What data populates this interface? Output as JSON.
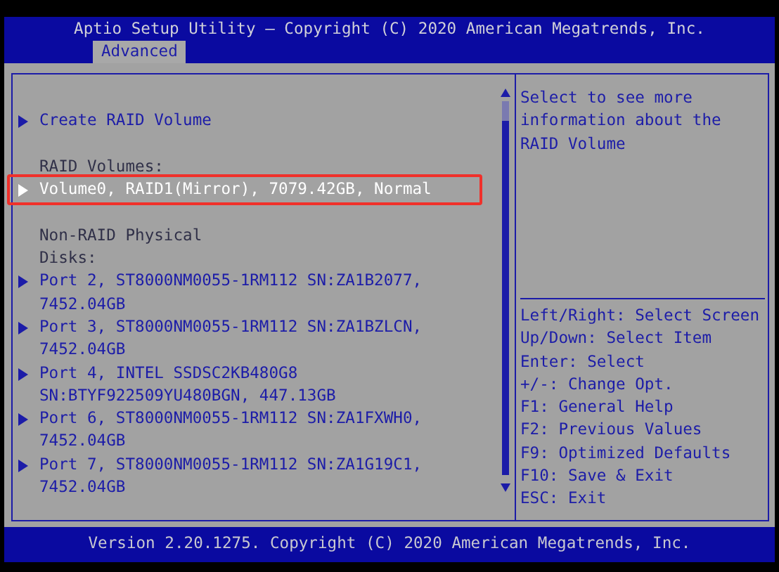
{
  "title": "Aptio Setup Utility – Copyright (C) 2020 American Megatrends, Inc.",
  "tabs": [
    {
      "label": "Advanced",
      "selected": true
    }
  ],
  "items": [
    {
      "kind": "blank"
    },
    {
      "kind": "link",
      "lines": [
        "Create RAID Volume"
      ],
      "selected": false
    },
    {
      "kind": "blank"
    },
    {
      "kind": "label",
      "lines": [
        "RAID Volumes:"
      ]
    },
    {
      "kind": "link",
      "lines": [
        "Volume0, RAID1(Mirror), 7079.42GB, Normal"
      ],
      "selected": true
    },
    {
      "kind": "blank"
    },
    {
      "kind": "label",
      "lines": [
        "Non-RAID Physical",
        "Disks:"
      ]
    },
    {
      "kind": "link",
      "lines": [
        "Port 2, ST8000NM0055-1RM112 SN:ZA1B2077,",
        "7452.04GB"
      ],
      "selected": false
    },
    {
      "kind": "link",
      "lines": [
        "Port 3, ST8000NM0055-1RM112 SN:ZA1BZLCN,",
        "7452.04GB"
      ],
      "selected": false
    },
    {
      "kind": "link",
      "lines": [
        "Port 4, INTEL SSDSC2KB480G8",
        "SN:BTYF922509YU480BGN, 447.13GB"
      ],
      "selected": false
    },
    {
      "kind": "link",
      "lines": [
        "Port 6, ST8000NM0055-1RM112 SN:ZA1FXWH0,",
        "7452.04GB"
      ],
      "selected": false
    },
    {
      "kind": "link",
      "lines": [
        "Port 7, ST8000NM0055-1RM112 SN:ZA1G19C1,",
        "7452.04GB"
      ],
      "selected": false
    }
  ],
  "help": [
    "Select to see more",
    "information about the",
    "RAID Volume"
  ],
  "keys": [
    "Left/Right: Select Screen",
    "Up/Down: Select Item",
    "Enter: Select",
    "+/-: Change Opt.",
    "F1: General Help",
    "F2: Previous Values",
    "F9: Optimized Defaults",
    "F10: Save & Exit",
    "ESC: Exit"
  ],
  "footer": "Version 2.20.1275. Copyright (C) 2020 American Megatrends, Inc."
}
